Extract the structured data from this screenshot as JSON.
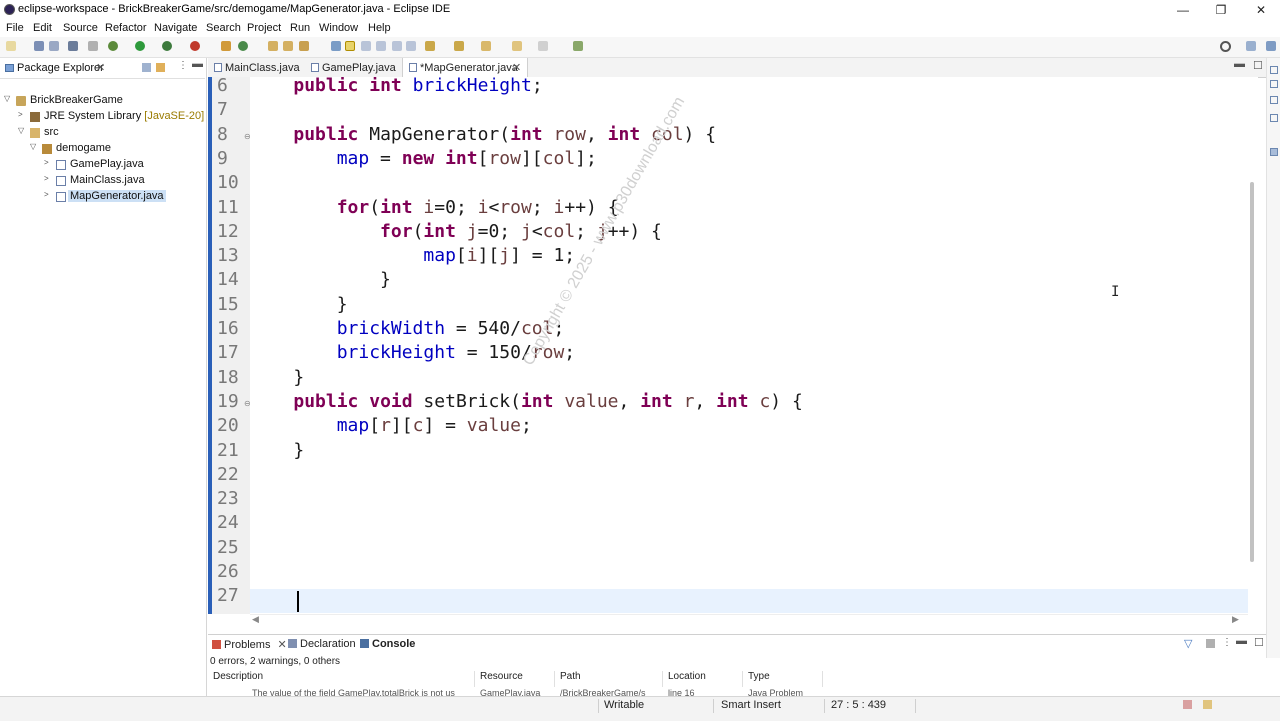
{
  "window": {
    "title": "eclipse-workspace - BrickBreakerGame/src/demogame/MapGenerator.java - Eclipse IDE",
    "minimize": "—",
    "maximize": "❐",
    "close": "✕"
  },
  "menu": [
    "File",
    "Edit",
    "Source",
    "Refactor",
    "Navigate",
    "Search",
    "Project",
    "Run",
    "Window",
    "Help"
  ],
  "package_explorer": {
    "tab_label": "Package Explorer",
    "tree": [
      {
        "label": "BrickBreakerGame",
        "icon": "project-icon",
        "expander": "▽"
      },
      {
        "label": "JRE System Library",
        "suffix": "[JavaSE-20]",
        "icon": "library-icon",
        "expander": ">"
      },
      {
        "label": "src",
        "icon": "source-folder-icon",
        "expander": "▽"
      },
      {
        "label": "demogame",
        "icon": "package-icon",
        "expander": "▽"
      },
      {
        "label": "GamePlay.java",
        "icon": "java-file-icon",
        "expander": ">"
      },
      {
        "label": "MainClass.java",
        "icon": "java-file-icon",
        "expander": ">"
      },
      {
        "label": "MapGenerator.java",
        "icon": "java-file-icon",
        "expander": ">",
        "selected": true
      }
    ]
  },
  "editor_tabs": [
    {
      "label": "MainClass.java"
    },
    {
      "label": "GamePlay.java"
    },
    {
      "label": "*MapGenerator.java",
      "active": true,
      "close": "✕"
    }
  ],
  "editor": {
    "line_numbers": [
      "6",
      "7",
      "8",
      "9",
      "10",
      "11",
      "12",
      "13",
      "14",
      "15",
      "16",
      "17",
      "18",
      "19",
      "20",
      "21",
      "22",
      "23",
      "24",
      "25",
      "26",
      "27"
    ],
    "lines": [
      [
        {
          "t": "    "
        },
        {
          "t": "public",
          "c": "kw"
        },
        {
          "t": " "
        },
        {
          "t": "int",
          "c": "kw"
        },
        {
          "t": " "
        },
        {
          "t": "brickHeight",
          "c": "fld"
        },
        {
          "t": ";"
        }
      ],
      [],
      [
        {
          "t": "    "
        },
        {
          "t": "public",
          "c": "kw"
        },
        {
          "t": " MapGenerator("
        },
        {
          "t": "int",
          "c": "kw"
        },
        {
          "t": " "
        },
        {
          "t": "row",
          "c": "prm"
        },
        {
          "t": ", "
        },
        {
          "t": "int",
          "c": "kw"
        },
        {
          "t": " "
        },
        {
          "t": "col",
          "c": "prm"
        },
        {
          "t": ") {"
        }
      ],
      [
        {
          "t": "        "
        },
        {
          "t": "map",
          "c": "fld"
        },
        {
          "t": " = "
        },
        {
          "t": "new",
          "c": "kw"
        },
        {
          "t": " "
        },
        {
          "t": "int",
          "c": "kw"
        },
        {
          "t": "["
        },
        {
          "t": "row",
          "c": "prm"
        },
        {
          "t": "]["
        },
        {
          "t": "col",
          "c": "prm"
        },
        {
          "t": "];"
        }
      ],
      [],
      [
        {
          "t": "        "
        },
        {
          "t": "for",
          "c": "kw"
        },
        {
          "t": "("
        },
        {
          "t": "int",
          "c": "kw"
        },
        {
          "t": " "
        },
        {
          "t": "i",
          "c": "prm"
        },
        {
          "t": "=0; "
        },
        {
          "t": "i",
          "c": "prm"
        },
        {
          "t": "<"
        },
        {
          "t": "row",
          "c": "prm"
        },
        {
          "t": "; "
        },
        {
          "t": "i",
          "c": "prm"
        },
        {
          "t": "++) {"
        }
      ],
      [
        {
          "t": "            "
        },
        {
          "t": "for",
          "c": "kw"
        },
        {
          "t": "("
        },
        {
          "t": "int",
          "c": "kw"
        },
        {
          "t": " "
        },
        {
          "t": "j",
          "c": "prm"
        },
        {
          "t": "=0; "
        },
        {
          "t": "j",
          "c": "prm"
        },
        {
          "t": "<"
        },
        {
          "t": "col",
          "c": "prm"
        },
        {
          "t": "; "
        },
        {
          "t": "j",
          "c": "prm"
        },
        {
          "t": "++) {"
        }
      ],
      [
        {
          "t": "                "
        },
        {
          "t": "map",
          "c": "fld"
        },
        {
          "t": "["
        },
        {
          "t": "i",
          "c": "prm"
        },
        {
          "t": "]["
        },
        {
          "t": "j",
          "c": "prm"
        },
        {
          "t": "] = 1;"
        }
      ],
      [
        {
          "t": "            }"
        }
      ],
      [
        {
          "t": "        }"
        }
      ],
      [
        {
          "t": "        "
        },
        {
          "t": "brickWidth",
          "c": "fld"
        },
        {
          "t": " = 540/"
        },
        {
          "t": "col",
          "c": "prm"
        },
        {
          "t": ";"
        }
      ],
      [
        {
          "t": "        "
        },
        {
          "t": "brickHeight",
          "c": "fld"
        },
        {
          "t": " = 150/"
        },
        {
          "t": "row",
          "c": "prm"
        },
        {
          "t": ";"
        }
      ],
      [
        {
          "t": "    }"
        }
      ],
      [
        {
          "t": "    "
        },
        {
          "t": "public",
          "c": "kw"
        },
        {
          "t": " "
        },
        {
          "t": "void",
          "c": "kw"
        },
        {
          "t": " setBrick("
        },
        {
          "t": "int",
          "c": "kw"
        },
        {
          "t": " "
        },
        {
          "t": "value",
          "c": "prm"
        },
        {
          "t": ", "
        },
        {
          "t": "int",
          "c": "kw"
        },
        {
          "t": " "
        },
        {
          "t": "r",
          "c": "prm"
        },
        {
          "t": ", "
        },
        {
          "t": "int",
          "c": "kw"
        },
        {
          "t": " "
        },
        {
          "t": "c",
          "c": "prm"
        },
        {
          "t": ") {"
        }
      ],
      [
        {
          "t": "        "
        },
        {
          "t": "map",
          "c": "fld"
        },
        {
          "t": "["
        },
        {
          "t": "r",
          "c": "prm"
        },
        {
          "t": "]["
        },
        {
          "t": "c",
          "c": "prm"
        },
        {
          "t": "] = "
        },
        {
          "t": "value",
          "c": "prm"
        },
        {
          "t": ";"
        }
      ],
      [
        {
          "t": "    }"
        }
      ],
      [],
      [],
      [],
      [],
      [],
      []
    ],
    "fold_markers": [
      "8",
      "19"
    ],
    "fold_glyph": "⊖",
    "watermark": "Copyright © 2025 - www.p30download.com",
    "ibeam": "I"
  },
  "bottom_panel": {
    "tabs": [
      {
        "label": "Problems",
        "icon": "problems-icon",
        "close": "✕"
      },
      {
        "label": "Declaration",
        "icon": "declaration-icon"
      },
      {
        "label": "Console",
        "icon": "console-icon",
        "active": true
      }
    ],
    "summary": "0 errors, 2 warnings, 0 others",
    "columns": [
      "Description",
      "Resource",
      "Path",
      "Location",
      "Type"
    ],
    "row": {
      "description": "The value of the field GamePlay.totalBrick is not us",
      "resource": "GamePlay.java",
      "path": "/BrickBreakerGame/s",
      "location": "line 16",
      "type": "Java Problem"
    }
  },
  "status_bar": {
    "writable": "Writable",
    "insert_mode": "Smart Insert",
    "position": "27 : 5 : 439"
  },
  "colors": {
    "keyword": "#7f0055",
    "field": "#0000c0",
    "parameter": "#6a3e3e",
    "current_line": "#e8f2fe",
    "ruler": "#2a5fb8"
  }
}
